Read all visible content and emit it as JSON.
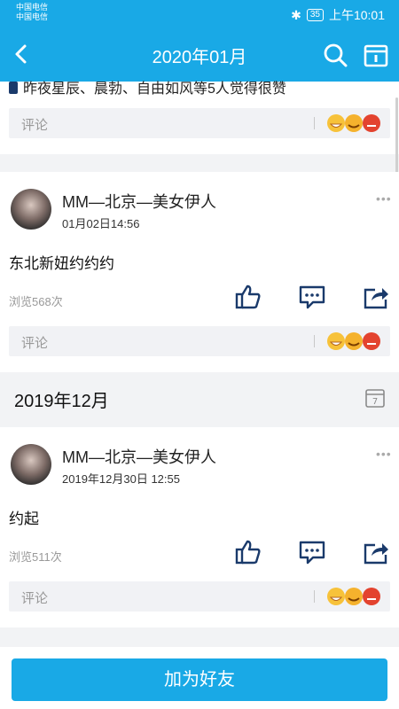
{
  "status_bar": {
    "carrier1": "中国电信",
    "carrier2": "中国电信",
    "battery": "35",
    "time": "上午10:01"
  },
  "header": {
    "title": "2020年01月"
  },
  "top_card": {
    "likes_text": "昨夜星辰、晨勃、自由如风等5人觉得很赞",
    "comment_placeholder": "评论"
  },
  "posts": [
    {
      "author": "MM—北京—美女伊人",
      "time": "01月02日14:56",
      "content": "东北新妞约约约",
      "views": "浏览568次",
      "comment_placeholder": "评论"
    },
    {
      "author": "MM—北京—美女伊人",
      "time": "2019年12月30日 12:55",
      "content": "约起",
      "views": "浏览511次",
      "comment_placeholder": "评论"
    }
  ],
  "section": {
    "title": "2019年12月",
    "calendar_day": "7"
  },
  "bottom": {
    "add_friend_label": "加为好友"
  },
  "colors": {
    "accent": "#19a9e6",
    "background": "#f2f3f5"
  }
}
